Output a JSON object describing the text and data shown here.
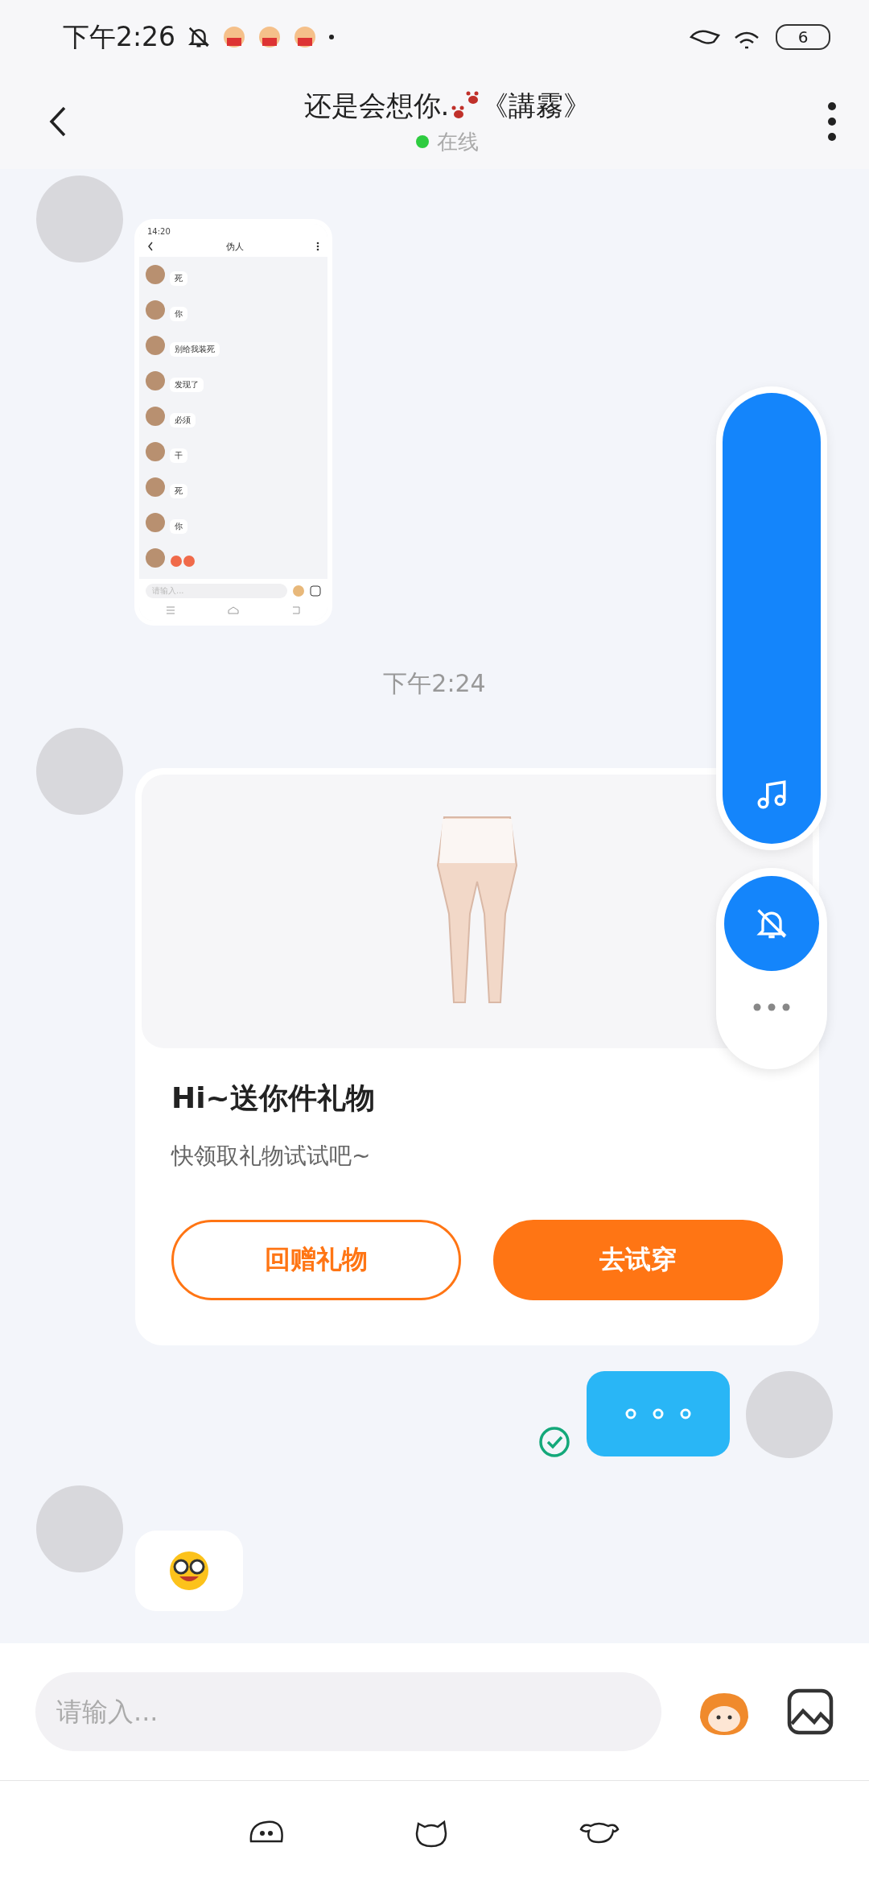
{
  "status_bar": {
    "time": "下午2:26",
    "battery": "6"
  },
  "header": {
    "title_start": "还是会想你.",
    "title_end": "《講霧》",
    "status": "在线",
    "online": true
  },
  "messages": [
    {
      "kind": "screenshot",
      "outgoing": false,
      "shot": {
        "time": "14:20",
        "title": "伪人",
        "lines": [
          "死",
          "你",
          "别给我装死",
          "发现了",
          "必须",
          "干",
          "死",
          "你"
        ],
        "placeholder": "请输入..."
      }
    },
    {
      "kind": "time",
      "text": "下午2:24"
    },
    {
      "kind": "gift",
      "outgoing": false,
      "title": "Hi~送你件礼物",
      "subtitle": "快领取礼物试试吧~",
      "buttons": [
        {
          "label": "回赠礼物",
          "kind": "outline"
        },
        {
          "label": "去试穿",
          "kind": "filled"
        }
      ]
    },
    {
      "kind": "typing",
      "outgoing": true,
      "read": true
    },
    {
      "kind": "emoji",
      "outgoing": false
    }
  ],
  "input": {
    "placeholder": "请输入..."
  }
}
